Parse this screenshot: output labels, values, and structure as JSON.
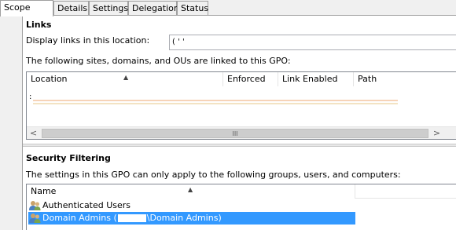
{
  "tabs": [
    {
      "label": "Scope",
      "active": true
    },
    {
      "label": "Details",
      "active": false
    },
    {
      "label": "Settings",
      "active": false
    },
    {
      "label": "Delegation",
      "active": false
    },
    {
      "label": "Status",
      "active": false
    }
  ],
  "links": {
    "title": "Links",
    "display_label": "Display links in this location:",
    "display_value": "(  '  '",
    "linked_description": "The following sites, domains, and OUs are linked to this GPO:",
    "columns": [
      "Location",
      "Enforced",
      "Link Enabled",
      "Path"
    ],
    "rows": [
      ":"
    ],
    "scroll_left": "<",
    "scroll_right": ">",
    "scroll_grip": "III"
  },
  "security": {
    "title": "Security Filtering",
    "description": "The settings in this GPO can only apply to the following groups, users, and computers:",
    "column": "Name",
    "items": [
      {
        "label": "Authenticated Users",
        "selected": false
      },
      {
        "label_prefix": "Domain Admins (",
        "label_suffix": "\\Domain Admins)",
        "selected": true
      }
    ]
  },
  "colors": {
    "selection": "#3399ff",
    "redaction_stripe_top": "#f6d3b8",
    "redaction_stripe_bottom": "#f3e3c3"
  }
}
